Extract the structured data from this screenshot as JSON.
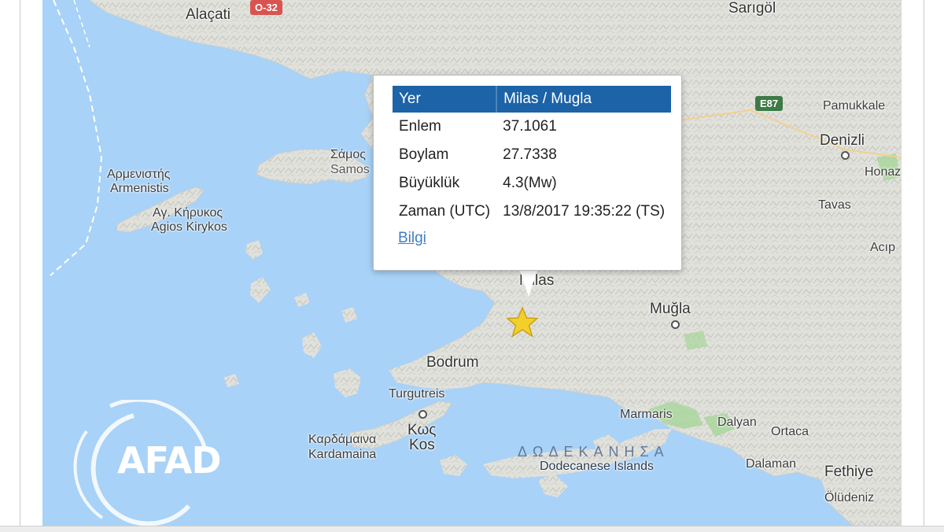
{
  "popup": {
    "header": {
      "key": "Yer",
      "value": "Milas / Mugla"
    },
    "rows": [
      {
        "key": "Enlem",
        "value": "37.1061"
      },
      {
        "key": "Boylam",
        "value": "27.7338"
      },
      {
        "key": "Büyüklük",
        "value": "4.3(Mw)"
      },
      {
        "key": "Zaman (UTC)",
        "value": "13/8/2017 19:35:22 (TS)"
      }
    ],
    "link": "Bilgi",
    "close_icon": "×"
  },
  "map": {
    "labels": {
      "alacati": "Alaçati",
      "sarigol": "Sarıgöl",
      "pamukkale": "Pamukkale",
      "denizli": "Denizli",
      "honaz": "Honaz",
      "tavas": "Tavas",
      "acip": "Acıp",
      "samos_gr": "Σάμος",
      "samos": "Samos",
      "armenistis_gr": "Αρμενιστής",
      "armenistis": "Armenistis",
      "agios_kirykos_gr": "Αγ. Κήρυκος",
      "agios_kirykos": "Agios Kirykos",
      "milas": "Milas",
      "mugla": "Muğla",
      "bodrum": "Bodrum",
      "turgutreis": "Turgutreis",
      "kos_gr": "Κως",
      "kos": "Kos",
      "kardamaina_gr": "Καρδάμαινα",
      "kardamaina": "Kardamaina",
      "marmaris": "Marmaris",
      "dalyan": "Dalyan",
      "ortaca": "Ortaca",
      "dalaman": "Dalaman",
      "fethiye": "Fethiye",
      "oludeniz": "Ölüdeniz",
      "dodecanese_gr": "ΔΩΔΕΚΑΝΗΣΑ",
      "dodecanese": "Dodecanese Islands",
      "partial_li": "li"
    },
    "roads": {
      "o32": "O-32",
      "e87": "E87"
    },
    "logo": "AFAD",
    "colors": {
      "sea": "#a8d2f7",
      "land": "#e2e2de",
      "header": "#1c63a8",
      "link": "#3f7fbf",
      "star": "#f2cf2a"
    }
  }
}
